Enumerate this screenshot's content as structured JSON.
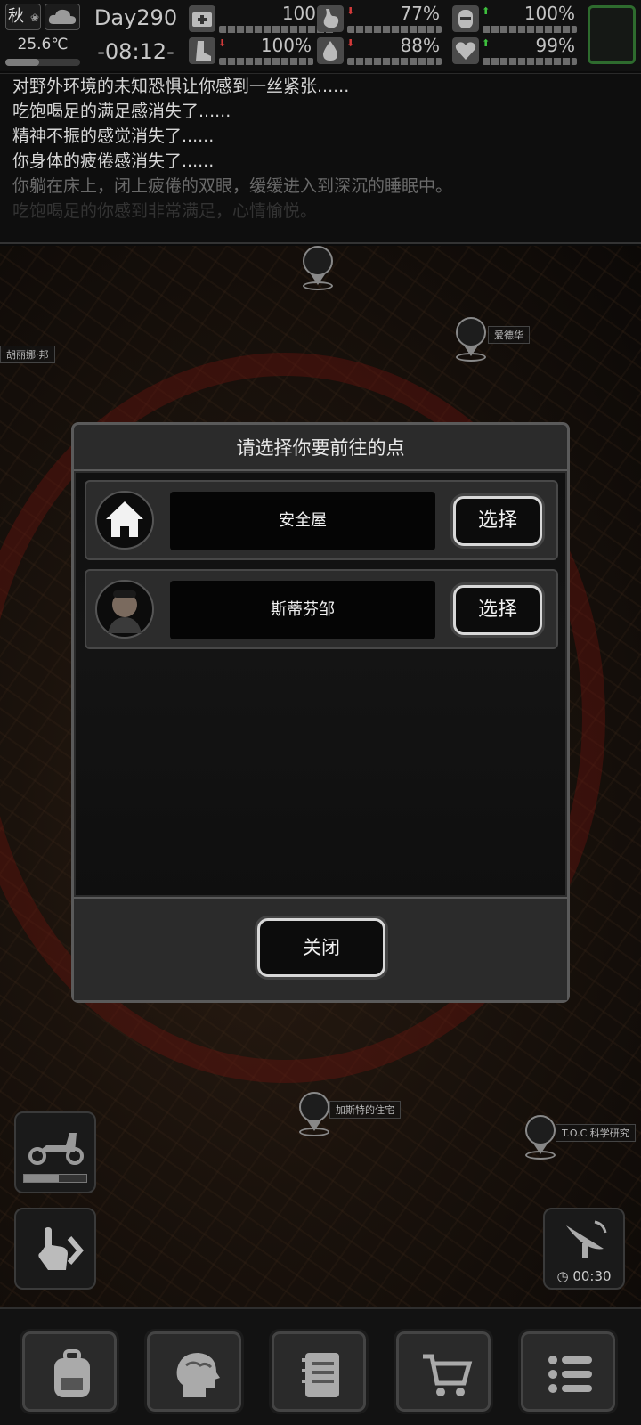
{
  "status": {
    "season": "秋",
    "temperature": "25.6℃",
    "day": "Day290",
    "time": "-08:12-",
    "stats": [
      {
        "name": "medical",
        "icon": "first-aid-kit-icon",
        "value": "100%",
        "trend": ""
      },
      {
        "name": "hunger",
        "icon": "stomach-icon",
        "value": "77%",
        "trend": "down"
      },
      {
        "name": "mood",
        "icon": "face-mask-icon",
        "value": "100%",
        "trend": "up"
      },
      {
        "name": "stamina",
        "icon": "boot-icon",
        "value": "100%",
        "trend": "down"
      },
      {
        "name": "thirst",
        "icon": "water-drop-icon",
        "value": "88%",
        "trend": "down"
      },
      {
        "name": "health",
        "icon": "heart-icon",
        "value": "99%",
        "trend": "up"
      }
    ]
  },
  "log": {
    "lines": [
      "对野外环境的未知恐惧让你感到一丝紧张......",
      "吃饱喝足的满足感消失了......",
      "精神不振的感觉消失了......",
      "你身体的疲倦感消失了......",
      "你躺在床上，闭上疲倦的双眼，缓缓进入到深沉的睡眠中。",
      "吃饱喝足的你感到非常满足，心情愉悦。"
    ]
  },
  "map": {
    "markers": [
      {
        "label": "爱德华"
      },
      {
        "label": "胡丽娜·邦"
      },
      {
        "label": "加斯特的住宅"
      },
      {
        "label": "T.O.C 科学研究"
      }
    ],
    "vehicle_fuel": 0.55,
    "radar_timer": "00:30"
  },
  "dialog": {
    "title": "请选择你要前往的点",
    "options": [
      {
        "name": "安全屋",
        "button": "选择",
        "icon": "house-icon"
      },
      {
        "name": "斯蒂芬邹",
        "button": "选择",
        "icon": "portrait-avatar"
      }
    ],
    "close_label": "关闭"
  },
  "nav": {
    "items": [
      {
        "icon": "backpack-icon"
      },
      {
        "icon": "brain-icon"
      },
      {
        "icon": "notebook-icon"
      },
      {
        "icon": "shopping-cart-icon"
      },
      {
        "icon": "menu-list-icon"
      }
    ]
  },
  "colors": {
    "up": "#3ec23e",
    "down": "#d23a3a",
    "slot_border": "#2e6b2e"
  }
}
